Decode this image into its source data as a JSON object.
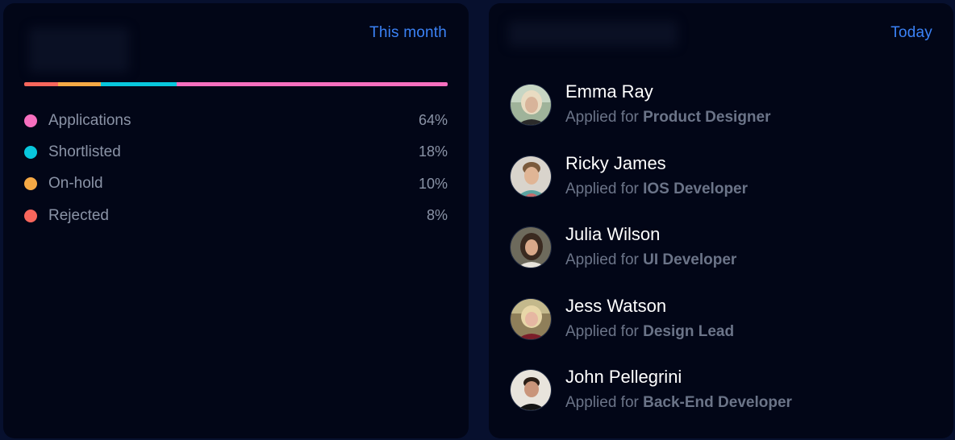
{
  "applications_card": {
    "period_label": "This month",
    "segments": [
      {
        "name": "Rejected",
        "percent": 8,
        "color": "#f8665c"
      },
      {
        "name": "On-hold",
        "percent": 10,
        "color": "#f6a945"
      },
      {
        "name": "Shortlisted",
        "percent": 18,
        "color": "#08c7dd"
      },
      {
        "name": "Applications",
        "percent": 64,
        "color": "#f76fbf"
      }
    ],
    "legend": [
      {
        "label": "Applications",
        "value": "64%",
        "color": "#f76fbf"
      },
      {
        "label": "Shortlisted",
        "value": "18%",
        "color": "#08c7dd"
      },
      {
        "label": "On-hold",
        "value": "10%",
        "color": "#f6a945"
      },
      {
        "label": "Rejected",
        "value": "8%",
        "color": "#f8665c"
      }
    ]
  },
  "applicants_card": {
    "period_label": "Today",
    "applied_prefix": "Applied for",
    "items": [
      {
        "name": "Emma Ray",
        "role": "Product Designer",
        "avatar": "avatar-emma"
      },
      {
        "name": "Ricky James",
        "role": "IOS Developer",
        "avatar": "avatar-ricky"
      },
      {
        "name": "Julia Wilson",
        "role": "UI Developer",
        "avatar": "avatar-julia"
      },
      {
        "name": "Jess Watson",
        "role": "Design Lead",
        "avatar": "avatar-jess"
      },
      {
        "name": "John Pellegrini",
        "role": "Back-End Developer",
        "avatar": "avatar-john"
      }
    ]
  }
}
